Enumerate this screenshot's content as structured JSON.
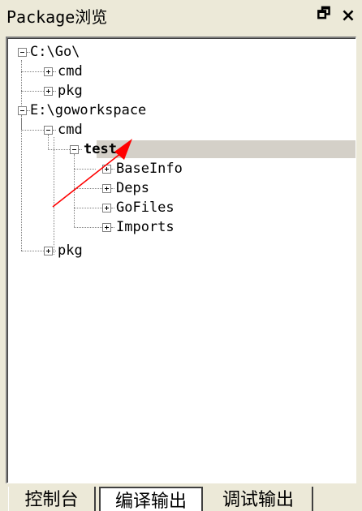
{
  "panel": {
    "title": "Package浏览",
    "float_button": "🗗",
    "close_button": "×"
  },
  "tree": {
    "nodes": [
      {
        "label": "C:\\Go\\",
        "state": "expanded"
      },
      {
        "label": "cmd",
        "state": "collapsed"
      },
      {
        "label": "pkg",
        "state": "collapsed"
      },
      {
        "label": "E:\\goworkspace",
        "state": "expanded"
      },
      {
        "label": "cmd",
        "state": "expanded"
      },
      {
        "label": "test",
        "state": "expanded",
        "selected": true
      },
      {
        "label": "BaseInfo",
        "state": "collapsed"
      },
      {
        "label": "Deps",
        "state": "collapsed"
      },
      {
        "label": "GoFiles",
        "state": "collapsed"
      },
      {
        "label": "Imports",
        "state": "collapsed"
      },
      {
        "label": "pkg",
        "state": "collapsed"
      }
    ]
  },
  "tabs": [
    {
      "label": "控制台"
    },
    {
      "label": "编译输出",
      "active": true
    },
    {
      "label": "调试输出"
    }
  ],
  "annotation": {
    "color": "#ff0000"
  }
}
